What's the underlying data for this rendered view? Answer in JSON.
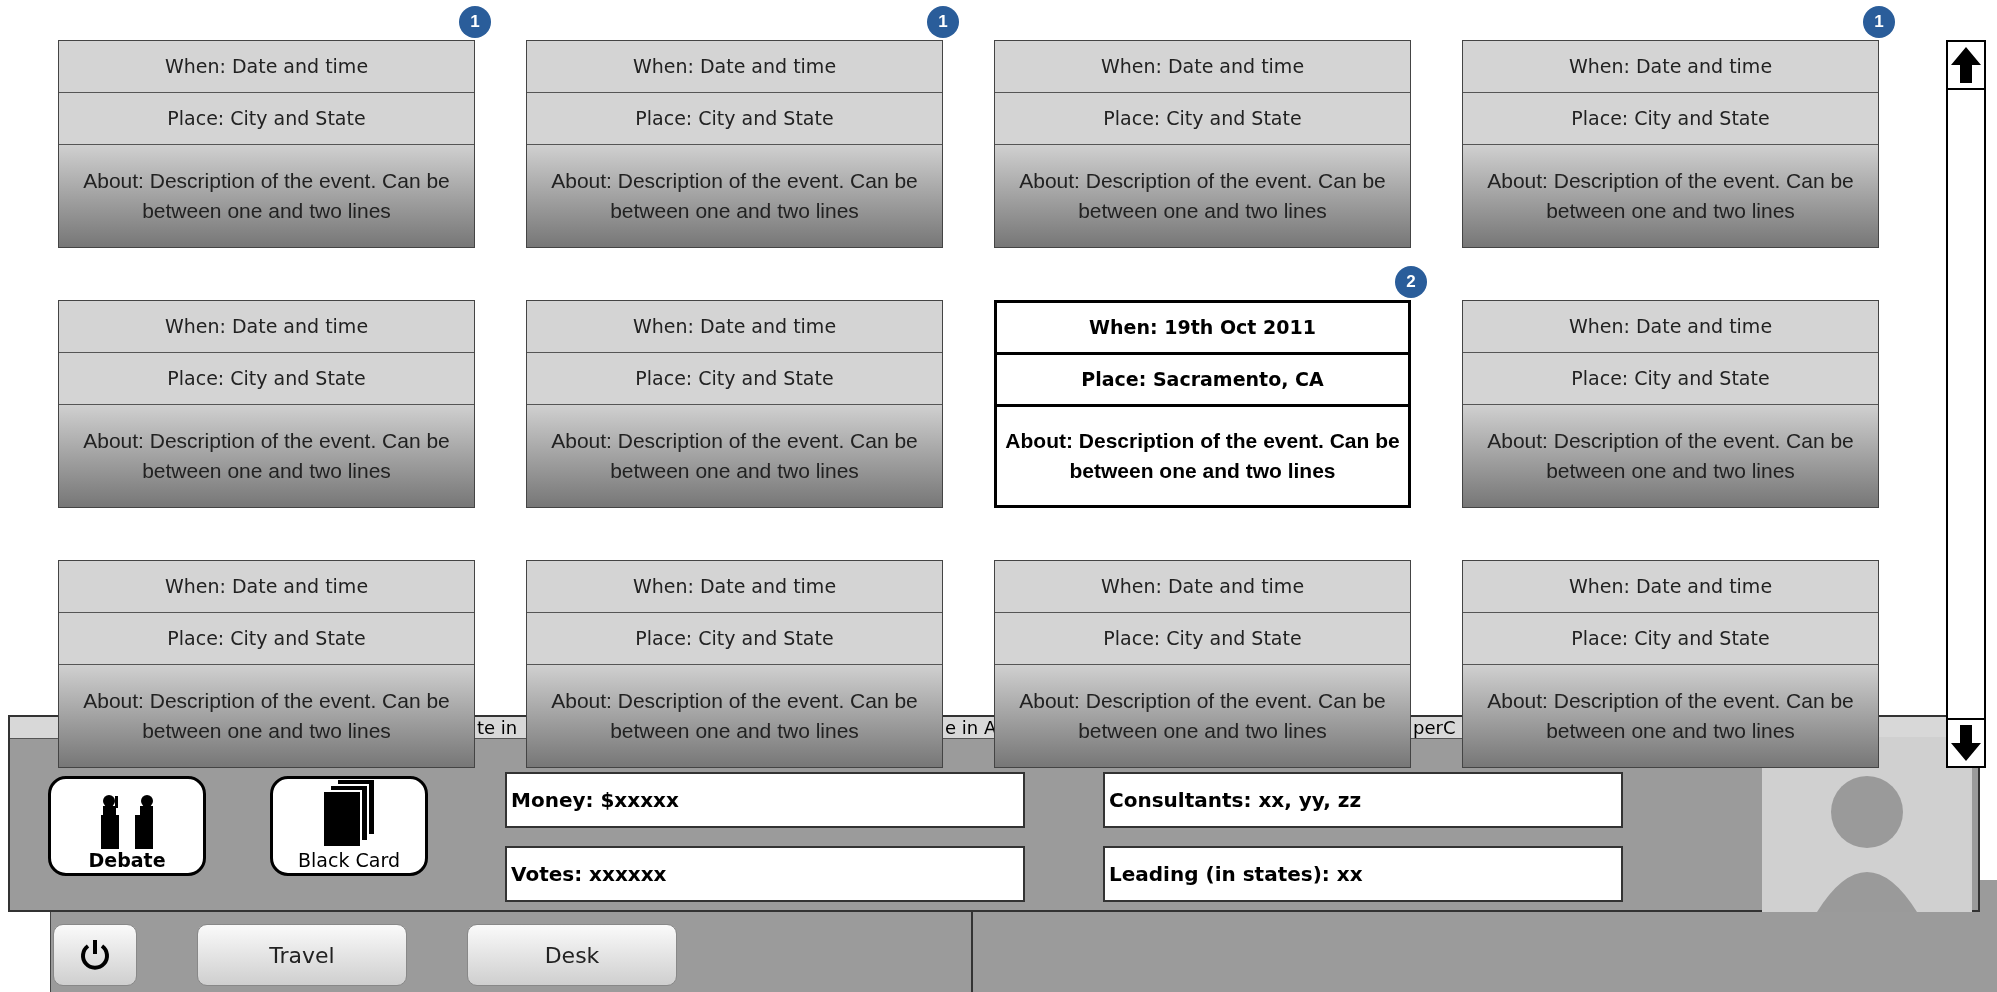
{
  "events": [
    {
      "when": "When: Date and time",
      "place": "Place: City and State",
      "about": "About: Description of the event. Can be between one and two lines",
      "selected": false,
      "badge": "1"
    },
    {
      "when": "When: Date and time",
      "place": "Place: City and State",
      "about": "About: Description of the event. Can be between one and two lines",
      "selected": false,
      "badge": "1"
    },
    {
      "when": "When: Date and time",
      "place": "Place: City and State",
      "about": "About: Description of the event. Can be between one and two lines",
      "selected": false
    },
    {
      "when": "When: Date and time",
      "place": "Place: City and State",
      "about": "About: Description of the event. Can be between one and two lines",
      "selected": false,
      "badge": "1"
    },
    {
      "when": "When: Date and time",
      "place": "Place: City and State",
      "about": "About: Description of the event. Can be between one and two lines",
      "selected": false
    },
    {
      "when": "When: Date and time",
      "place": "Place: City and State",
      "about": "About: Description of the event. Can be between one and two lines",
      "selected": false
    },
    {
      "when": "When: 19th Oct 2011",
      "place": "Place: Sacramento, CA",
      "about": "About: Description of the event. Can be between one and two lines",
      "selected": true,
      "badge": "2"
    },
    {
      "when": "When: Date and time",
      "place": "Place: City and State",
      "about": "About: Description of the event. Can be between one and two lines",
      "selected": false
    },
    {
      "when": "When: Date and time",
      "place": "Place: City and State",
      "about": "About: Description of the event. Can be between one and two lines",
      "selected": false
    },
    {
      "when": "When: Date and time",
      "place": "Place: City and State",
      "about": "About: Description of the event. Can be between one and two lines",
      "selected": false
    },
    {
      "when": "When: Date and time",
      "place": "Place: City and State",
      "about": "About: Description of the event. Can be between one and two lines",
      "selected": false
    },
    {
      "when": "When: Date and time",
      "place": "Place: City and State",
      "about": "About: Description of the event. Can be between one and two lines",
      "selected": false
    }
  ],
  "tab_fragments": [
    "te in",
    "e in A",
    "perC"
  ],
  "actions": [
    {
      "kind": "debate",
      "label": "Debate"
    },
    {
      "kind": "cards",
      "label": "Black Card"
    }
  ],
  "stats": [
    {
      "label": "Money: $xxxxx"
    },
    {
      "label": "Consultants: xx, yy, zz"
    },
    {
      "label": "Votes: xxxxxx"
    },
    {
      "label": "Leading (in states): xx"
    }
  ],
  "toolbar": [
    "Travel",
    "Desk"
  ]
}
